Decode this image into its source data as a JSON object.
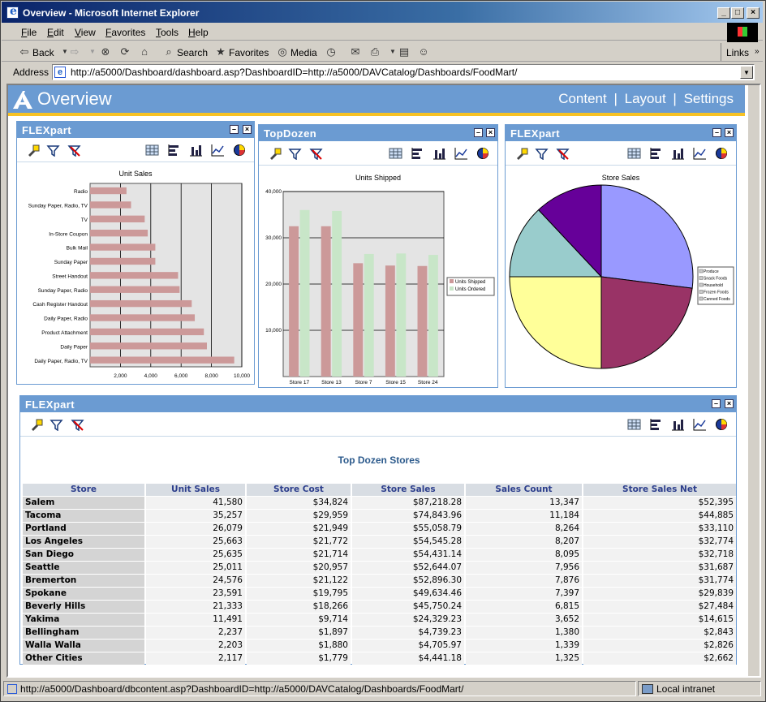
{
  "window": {
    "title": "Overview - Microsoft Internet Explorer"
  },
  "menu": [
    "File",
    "Edit",
    "View",
    "Favorites",
    "Tools",
    "Help"
  ],
  "toolbar": {
    "back": "Back",
    "search": "Search",
    "favorites": "Favorites",
    "media": "Media",
    "links": "Links"
  },
  "address": {
    "label": "Address",
    "url": "http://a5000/Dashboard/dashboard.asp?DashboardID=http://a5000/DAVCatalog/Dashboards/FoodMart/"
  },
  "page": {
    "title": "Overview",
    "nav": [
      "Content",
      "Layout",
      "Settings"
    ],
    "nav_sep": "|"
  },
  "panels": {
    "p1": {
      "title": "FLEXpart"
    },
    "p2": {
      "title": "TopDozen"
    },
    "p3": {
      "title": "FLEXpart"
    },
    "p4": {
      "title": "FLEXpart"
    }
  },
  "chart_data": [
    {
      "type": "bar",
      "orientation": "horizontal",
      "title": "Unit Sales",
      "categories": [
        "Radio",
        "Sunday Paper, Radio, TV",
        "TV",
        "In-Store Coupon",
        "Bulk Mail",
        "Sunday Paper",
        "Street Handout",
        "Sunday Paper, Radio",
        "Cash Register Handout",
        "Daily Paper, Radio",
        "Product Attachment",
        "Daily Paper",
        "Daily Paper, Radio, TV"
      ],
      "values": [
        2400,
        2700,
        3600,
        3800,
        4300,
        4300,
        5800,
        5900,
        6700,
        6900,
        7500,
        7700,
        9500
      ],
      "xlim": [
        0,
        10000
      ],
      "xticks": [
        "2,000",
        "4,000",
        "6,000",
        "8,000",
        "10,000"
      ],
      "color": "#cc9999"
    },
    {
      "type": "bar",
      "title": "Units Shipped",
      "categories": [
        "Store 17",
        "Store 13",
        "Store 7",
        "Store 15",
        "Store 24"
      ],
      "series": [
        {
          "name": "Units Shipped",
          "values": [
            32500,
            32500,
            24500,
            24000,
            23900
          ],
          "color": "#cc9999"
        },
        {
          "name": "Units Ordered",
          "values": [
            36000,
            35800,
            26500,
            26600,
            26300
          ],
          "color": "#c8e6c8"
        }
      ],
      "ylim": [
        0,
        40000
      ],
      "yticks": [
        "10,000",
        "20,000",
        "30,000",
        "40,000"
      ],
      "legend": "right"
    },
    {
      "type": "pie",
      "title": "Store Sales",
      "legend_entries": [
        "Produce",
        "Snack Foods",
        "Household",
        "Frozen Foods",
        "Canned Foods"
      ],
      "values": [
        28,
        23,
        26,
        13,
        10
      ],
      "slices": [
        {
          "value": 27,
          "color": "#9999ff"
        },
        {
          "value": 23,
          "color": "#993366"
        },
        {
          "value": 25,
          "color": "#ffff99"
        },
        {
          "value": 13,
          "color": "#99cccc"
        },
        {
          "value": 12,
          "color": "#660099"
        }
      ],
      "legend": "right"
    }
  ],
  "grid": {
    "title": "Top Dozen Stores",
    "columns": [
      "Store",
      "Unit Sales",
      "Store Cost",
      "Store Sales",
      "Sales Count",
      "Store Sales Net"
    ],
    "rows": [
      [
        "Salem",
        "41,580",
        "$34,824",
        "$87,218.28",
        "13,347",
        "$52,395"
      ],
      [
        "Tacoma",
        "35,257",
        "$29,959",
        "$74,843.96",
        "11,184",
        "$44,885"
      ],
      [
        "Portland",
        "26,079",
        "$21,949",
        "$55,058.79",
        "8,264",
        "$33,110"
      ],
      [
        "Los Angeles",
        "25,663",
        "$21,772",
        "$54,545.28",
        "8,207",
        "$32,774"
      ],
      [
        "San Diego",
        "25,635",
        "$21,714",
        "$54,431.14",
        "8,095",
        "$32,718"
      ],
      [
        "Seattle",
        "25,011",
        "$20,957",
        "$52,644.07",
        "7,956",
        "$31,687"
      ],
      [
        "Bremerton",
        "24,576",
        "$21,122",
        "$52,896.30",
        "7,876",
        "$31,774"
      ],
      [
        "Spokane",
        "23,591",
        "$19,795",
        "$49,634.46",
        "7,397",
        "$29,839"
      ],
      [
        "Beverly Hills",
        "21,333",
        "$18,266",
        "$45,750.24",
        "6,815",
        "$27,484"
      ],
      [
        "Yakima",
        "11,491",
        "$9,714",
        "$24,329.23",
        "3,652",
        "$14,615"
      ],
      [
        "Bellingham",
        "2,237",
        "$1,897",
        "$4,739.23",
        "1,380",
        "$2,843"
      ],
      [
        "Walla Walla",
        "2,203",
        "$1,880",
        "$4,705.97",
        "1,339",
        "$2,826"
      ],
      [
        "Other Cities",
        "2,117",
        "$1,779",
        "$4,441.18",
        "1,325",
        "$2,662"
      ]
    ]
  },
  "status": {
    "url": "http://a5000/Dashboard/dbcontent.asp?DashboardID=http://a5000/DAVCatalog/Dashboards/FoodMart/",
    "zone": "Local intranet"
  }
}
